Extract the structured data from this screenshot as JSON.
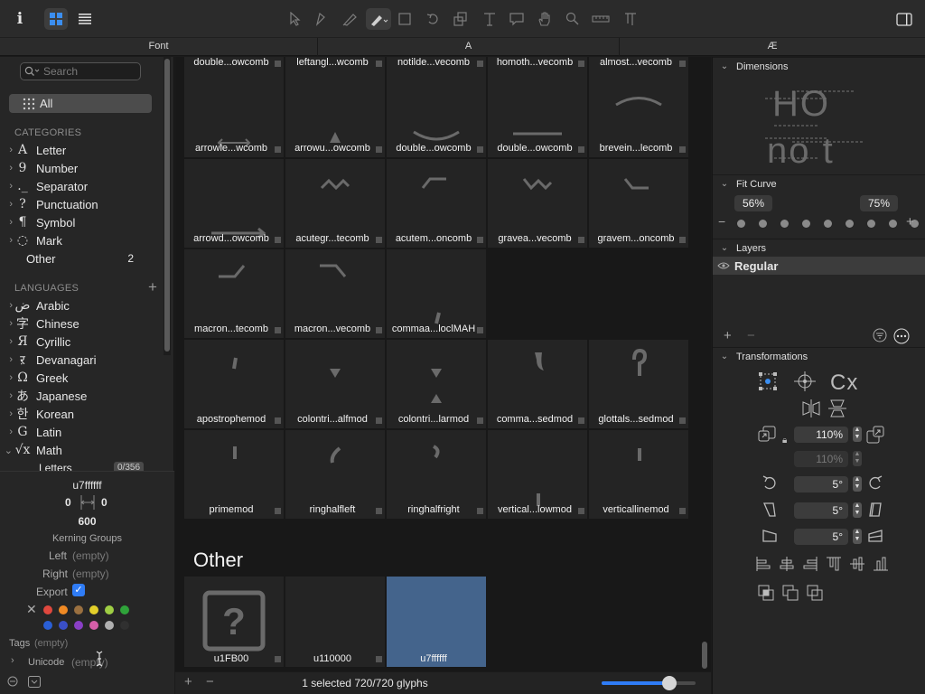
{
  "toolbar": {
    "info_icon_glyph": "i",
    "tool_icons": [
      "select-tool-icon",
      "select-all-tool-icon",
      "draw-tool-icon",
      "pen-tool-icon",
      "primitives-tool-icon",
      "rotate-tool-icon",
      "scale-tool-icon",
      "text-tool-icon",
      "annotation-tool-icon",
      "hand-tool-icon",
      "zoom-tool-icon",
      "measure-tool-icon",
      "anchor-tool-icon"
    ]
  },
  "tabs": [
    "Font",
    "A",
    "Æ"
  ],
  "sidebar": {
    "search_placeholder": "Search",
    "all_label": "All",
    "categories_header": "CATEGORIES",
    "categories": [
      {
        "glyph": "A",
        "label": "Letter"
      },
      {
        "glyph": "9",
        "label": "Number"
      },
      {
        "glyph": "._",
        "label": "Separator"
      },
      {
        "glyph": "?",
        "label": "Punctuation"
      },
      {
        "glyph": "¶",
        "label": "Symbol"
      },
      {
        "glyph": "◌",
        "label": "Mark"
      }
    ],
    "other": {
      "label": "Other",
      "count": "2"
    },
    "languages_header": "LANGUAGES",
    "languages": [
      {
        "glyph": "ض",
        "label": "Arabic"
      },
      {
        "glyph": "字",
        "label": "Chinese"
      },
      {
        "glyph": "Я",
        "label": "Cyrillic"
      },
      {
        "glyph": "ऱ",
        "label": "Devanagari"
      },
      {
        "glyph": "Ω",
        "label": "Greek"
      },
      {
        "glyph": "あ",
        "label": "Japanese"
      },
      {
        "glyph": "한",
        "label": "Korean"
      },
      {
        "glyph": "G",
        "label": "Latin"
      },
      {
        "glyph": "√x",
        "label": "Math"
      }
    ],
    "math_sub": {
      "label": "Letters",
      "count": "0/356"
    }
  },
  "glyph_info": {
    "name": "u7ffffff",
    "lsb": "0",
    "rsb": "0",
    "width": "600",
    "kerning_label": "Kerning Groups",
    "left_label": "Left",
    "left_value": "(empty)",
    "right_label": "Right",
    "right_value": "(empty)",
    "export_label": "Export",
    "colors": [
      "#e0483e",
      "#f08a24",
      "#9a7040",
      "#e3cf2a",
      "#9fce44",
      "#2fa33a",
      "#2a5fd6",
      "#3a4fc8",
      "#8a3fc6",
      "#d55fa8",
      "#b0b0b0",
      "#303030"
    ],
    "tags_label": "Tags",
    "tags_value": "(empty)",
    "unicode_label": "Unicode",
    "unicode_value": "(empty)"
  },
  "grid": {
    "row0_names": [
      "double...owcomb",
      "leftangl...wcomb",
      "notilde...vecomb",
      "homoth...vecomb",
      "almost...vecomb"
    ],
    "rows": [
      [
        "arrowle...wcomb",
        "arrowu...owcomb",
        "double...owcomb",
        "double...owcomb",
        "brevein...lecomb"
      ],
      [
        "arrowd...owcomb",
        "acutegr...tecomb",
        "acutem...oncomb",
        "gravea...vecomb",
        "gravem...oncomb"
      ],
      [
        "macron...tecomb",
        "macron...vecomb",
        "commaa...loclMAH"
      ],
      [
        "apostrophemod",
        "colontri...alfmod",
        "colontri...larmod",
        "comma...sedmod",
        "glottals...sedmod"
      ],
      [
        "primemod",
        "ringhalfleft",
        "ringhalfright",
        "vertical...lowmod",
        "verticallinemod"
      ]
    ],
    "other_title": "Other",
    "other_glyphs": [
      "u1FB00",
      "u110000",
      "u7ffffff"
    ],
    "status": "1 selected 720/720 glyphs",
    "zoom_fraction": 0.72
  },
  "right_panel": {
    "dimensions_header": "Dimensions",
    "dim_preview_top": "HO",
    "dim_preview_bottom": "no t",
    "fit_curve_header": "Fit Curve",
    "fit_left": "56%",
    "fit_right": "75%",
    "layers_header": "Layers",
    "layer_name": "Regular",
    "transformations_header": "Transformations",
    "scale_x": "110%",
    "scale_y": "110%",
    "rotate": "5°",
    "slant": "5°",
    "skew": "5°",
    "cx_label": "Cx"
  }
}
